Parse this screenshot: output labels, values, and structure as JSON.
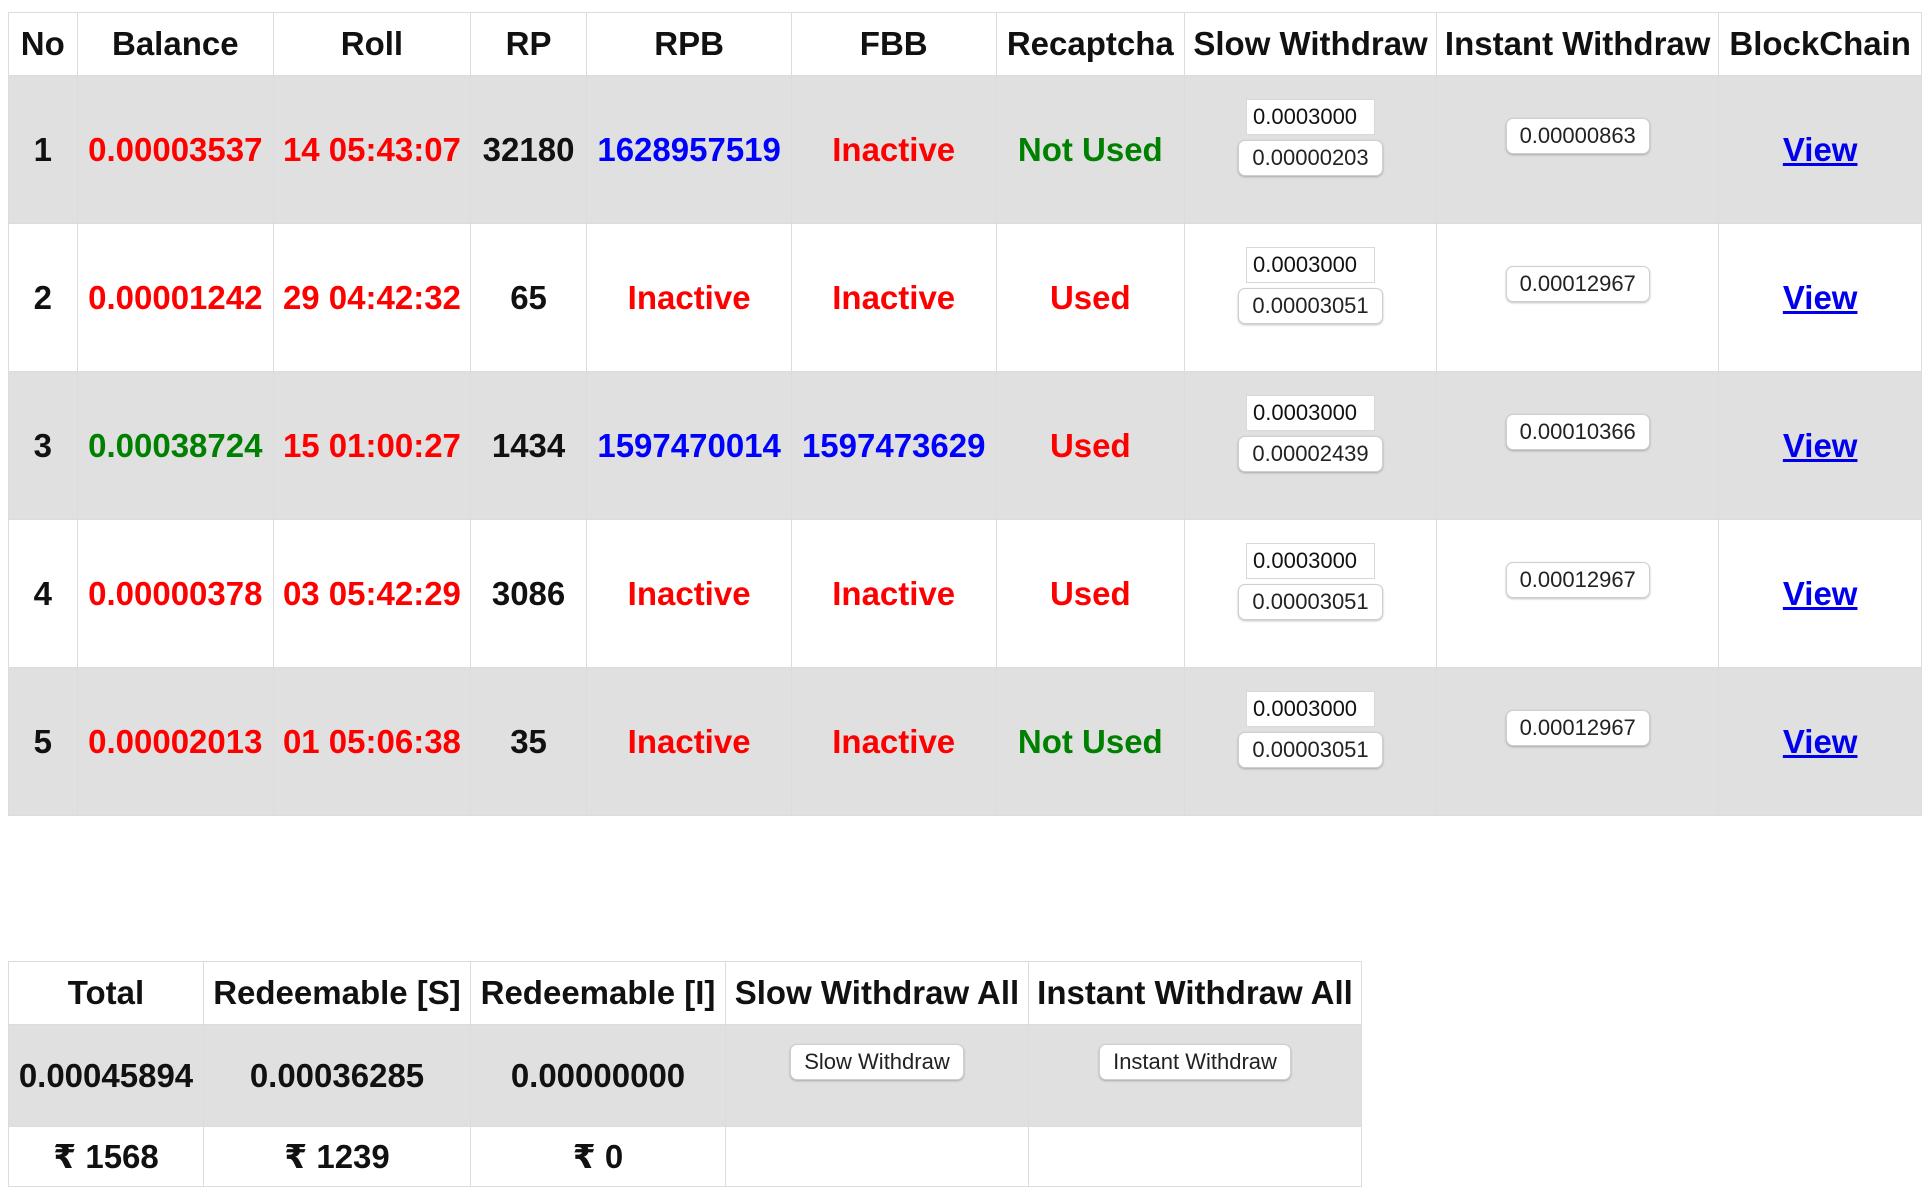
{
  "main_table": {
    "headers": [
      "No",
      "Balance",
      "Roll",
      "RP",
      "RPB",
      "FBB",
      "Recaptcha",
      "Slow Withdraw",
      "Instant Withdraw",
      "BlockChain"
    ],
    "rows": [
      {
        "no": "1",
        "balance": "0.00003537",
        "roll": "14 05:43:07",
        "rp": "32180",
        "rpb": "1628957519",
        "fbb": "Inactive",
        "recaptcha": "Not Used",
        "slow_amount": "0.0003000",
        "slow_button": "0.00000203",
        "instant_button": "0.00000863",
        "blockchain": "View"
      },
      {
        "no": "2",
        "balance": "0.00001242",
        "roll": "29 04:42:32",
        "rp": "65",
        "rpb": "Inactive",
        "fbb": "Inactive",
        "recaptcha": "Used",
        "slow_amount": "0.0003000",
        "slow_button": "0.00003051",
        "instant_button": "0.00012967",
        "blockchain": "View"
      },
      {
        "no": "3",
        "balance": "0.00038724",
        "roll": "15 01:00:27",
        "rp": "1434",
        "rpb": "1597470014",
        "fbb": "1597473629",
        "recaptcha": "Used",
        "slow_amount": "0.0003000",
        "slow_button": "0.00002439",
        "instant_button": "0.00010366",
        "blockchain": "View"
      },
      {
        "no": "4",
        "balance": "0.00000378",
        "roll": "03 05:42:29",
        "rp": "3086",
        "rpb": "Inactive",
        "fbb": "Inactive",
        "recaptcha": "Used",
        "slow_amount": "0.0003000",
        "slow_button": "0.00003051",
        "instant_button": "0.00012967",
        "blockchain": "View"
      },
      {
        "no": "5",
        "balance": "0.00002013",
        "roll": "01 05:06:38",
        "rp": "35",
        "rpb": "Inactive",
        "fbb": "Inactive",
        "recaptcha": "Not Used",
        "slow_amount": "0.0003000",
        "slow_button": "0.00003051",
        "instant_button": "0.00012967",
        "blockchain": "View"
      }
    ]
  },
  "summary": {
    "headers": [
      "Total",
      "Redeemable [S]",
      "Redeemable [I]",
      "Slow Withdraw All",
      "Instant Withdraw All"
    ],
    "total": "0.00045894",
    "redeemable_s": "0.00036285",
    "redeemable_i": "0.00000000",
    "slow_withdraw_button": "Slow Withdraw",
    "instant_withdraw_button": "Instant Withdraw",
    "total_inr": "₹ 1568",
    "redeemable_s_inr": "₹ 1239",
    "redeemable_i_inr": "₹ 0"
  },
  "colors": {
    "negative": "#ff0000",
    "positive": "#008000",
    "active_timestamp": "#0000ff",
    "link": "#0000ee",
    "row_shade": "#e0e0e0"
  }
}
